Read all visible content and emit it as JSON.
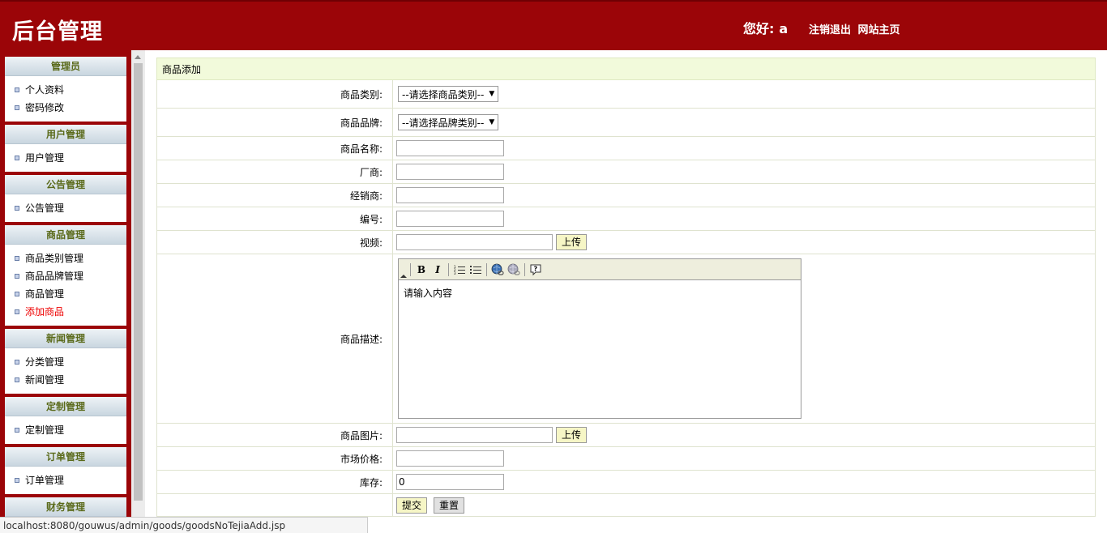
{
  "header": {
    "title": "后台管理",
    "greeting": "您好:",
    "username": "a",
    "logout_label": "注销退出",
    "home_label": "网站主页"
  },
  "sidebar": {
    "groups": [
      {
        "title": "管理员",
        "items": [
          "个人资料",
          "密码修改"
        ]
      },
      {
        "title": "用户管理",
        "items": [
          "用户管理"
        ]
      },
      {
        "title": "公告管理",
        "items": [
          "公告管理"
        ]
      },
      {
        "title": "商品管理",
        "items": [
          "商品类别管理",
          "商品品牌管理",
          "商品管理",
          "添加商品"
        ]
      },
      {
        "title": "新闻管理",
        "items": [
          "分类管理",
          "新闻管理"
        ]
      },
      {
        "title": "定制管理",
        "items": [
          "定制管理"
        ]
      },
      {
        "title": "订单管理",
        "items": [
          "订单管理"
        ]
      },
      {
        "title": "财务管理",
        "items": []
      }
    ],
    "active_item": "添加商品",
    "active_color": "#ee0000"
  },
  "form": {
    "title": "商品添加",
    "category_label": "商品类别:",
    "category_value": "--请选择商品类别--",
    "brand_label": "商品品牌:",
    "brand_value": "--请选择品牌类别--",
    "name_label": "商品名称:",
    "name_value": "",
    "maker_label": "厂商:",
    "maker_value": "",
    "dealer_label": "经销商:",
    "dealer_value": "",
    "code_label": "编号:",
    "code_value": "",
    "video_label": "视频:",
    "video_value": "",
    "upload_label": "上传",
    "desc_label": "商品描述:",
    "editor_placeholder": "请输入内容",
    "image_label": "商品图片:",
    "image_value": "",
    "price_label": "市场价格:",
    "price_value": "",
    "stock_label": "库存:",
    "stock_value": "0",
    "submit_label": "提交",
    "reset_label": "重置"
  },
  "statusbar": {
    "url": "localhost:8080/gouwus/admin/goods/goodsNoTejiaAdd.jsp"
  },
  "colors": {
    "header_bg": "#9b0508",
    "form_title_bg": "#f2fadb"
  }
}
